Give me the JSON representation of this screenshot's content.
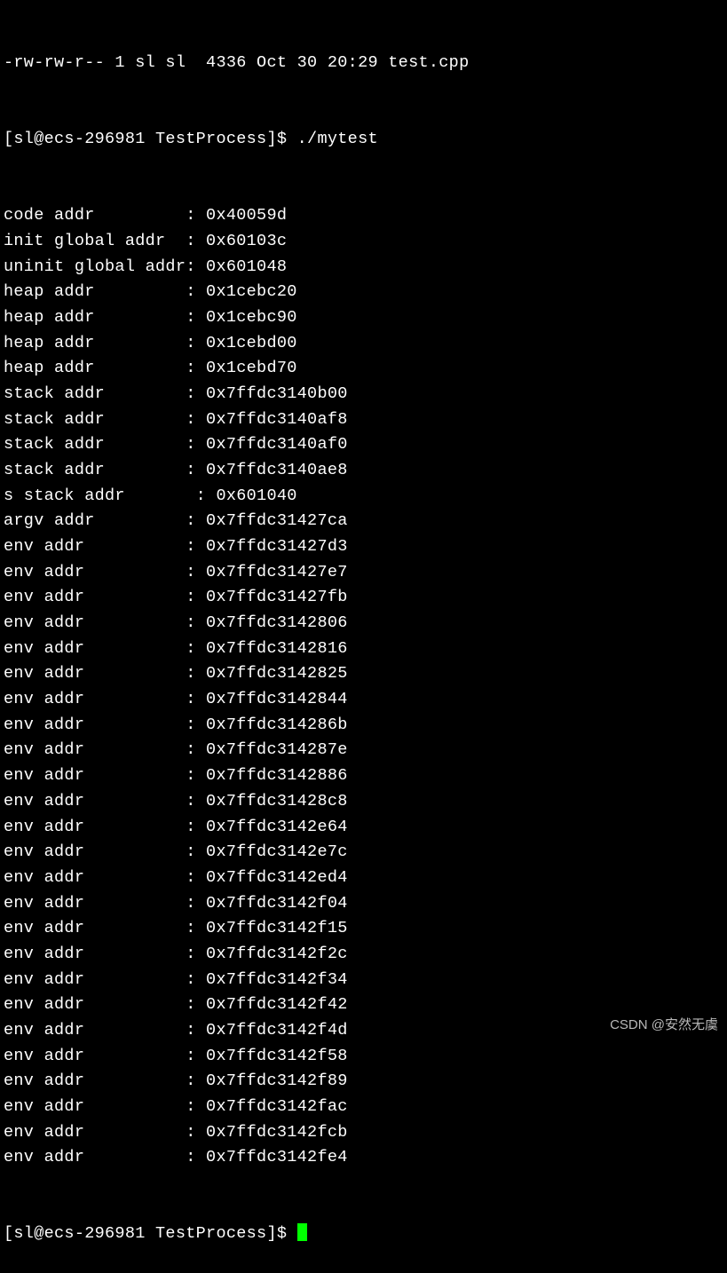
{
  "top_partial_line": "-rw-rw-r-- 1 sl sl  4336 Oct 30 20:29 test.cpp",
  "prompt1": "[sl@ecs-296981 TestProcess]$ ",
  "command1": "./mytest",
  "output_lines": [
    {
      "label": "code addr         ",
      "sep": ": ",
      "value": "0x40059d"
    },
    {
      "label": "init global addr  ",
      "sep": ": ",
      "value": "0x60103c"
    },
    {
      "label": "uninit global addr",
      "sep": ": ",
      "value": "0x601048"
    },
    {
      "label": "heap addr         ",
      "sep": ": ",
      "value": "0x1cebc20"
    },
    {
      "label": "heap addr         ",
      "sep": ": ",
      "value": "0x1cebc90"
    },
    {
      "label": "heap addr         ",
      "sep": ": ",
      "value": "0x1cebd00"
    },
    {
      "label": "heap addr         ",
      "sep": ": ",
      "value": "0x1cebd70"
    },
    {
      "label": "stack addr        ",
      "sep": ": ",
      "value": "0x7ffdc3140b00"
    },
    {
      "label": "stack addr        ",
      "sep": ": ",
      "value": "0x7ffdc3140af8"
    },
    {
      "label": "stack addr        ",
      "sep": ": ",
      "value": "0x7ffdc3140af0"
    },
    {
      "label": "stack addr        ",
      "sep": ": ",
      "value": "0x7ffdc3140ae8"
    },
    {
      "label": "s stack addr      ",
      "sep": " : ",
      "value": "0x601040"
    },
    {
      "label": "argv addr         ",
      "sep": ": ",
      "value": "0x7ffdc31427ca"
    },
    {
      "label": "env addr          ",
      "sep": ": ",
      "value": "0x7ffdc31427d3"
    },
    {
      "label": "env addr          ",
      "sep": ": ",
      "value": "0x7ffdc31427e7"
    },
    {
      "label": "env addr          ",
      "sep": ": ",
      "value": "0x7ffdc31427fb"
    },
    {
      "label": "env addr          ",
      "sep": ": ",
      "value": "0x7ffdc3142806"
    },
    {
      "label": "env addr          ",
      "sep": ": ",
      "value": "0x7ffdc3142816"
    },
    {
      "label": "env addr          ",
      "sep": ": ",
      "value": "0x7ffdc3142825"
    },
    {
      "label": "env addr          ",
      "sep": ": ",
      "value": "0x7ffdc3142844"
    },
    {
      "label": "env addr          ",
      "sep": ": ",
      "value": "0x7ffdc314286b"
    },
    {
      "label": "env addr          ",
      "sep": ": ",
      "value": "0x7ffdc314287e"
    },
    {
      "label": "env addr          ",
      "sep": ": ",
      "value": "0x7ffdc3142886"
    },
    {
      "label": "env addr          ",
      "sep": ": ",
      "value": "0x7ffdc31428c8"
    },
    {
      "label": "env addr          ",
      "sep": ": ",
      "value": "0x7ffdc3142e64"
    },
    {
      "label": "env addr          ",
      "sep": ": ",
      "value": "0x7ffdc3142e7c"
    },
    {
      "label": "env addr          ",
      "sep": ": ",
      "value": "0x7ffdc3142ed4"
    },
    {
      "label": "env addr          ",
      "sep": ": ",
      "value": "0x7ffdc3142f04"
    },
    {
      "label": "env addr          ",
      "sep": ": ",
      "value": "0x7ffdc3142f15"
    },
    {
      "label": "env addr          ",
      "sep": ": ",
      "value": "0x7ffdc3142f2c"
    },
    {
      "label": "env addr          ",
      "sep": ": ",
      "value": "0x7ffdc3142f34"
    },
    {
      "label": "env addr          ",
      "sep": ": ",
      "value": "0x7ffdc3142f42"
    },
    {
      "label": "env addr          ",
      "sep": ": ",
      "value": "0x7ffdc3142f4d"
    },
    {
      "label": "env addr          ",
      "sep": ": ",
      "value": "0x7ffdc3142f58"
    },
    {
      "label": "env addr          ",
      "sep": ": ",
      "value": "0x7ffdc3142f89"
    },
    {
      "label": "env addr          ",
      "sep": ": ",
      "value": "0x7ffdc3142fac"
    },
    {
      "label": "env addr          ",
      "sep": ": ",
      "value": "0x7ffdc3142fcb"
    },
    {
      "label": "env addr          ",
      "sep": ": ",
      "value": "0x7ffdc3142fe4"
    }
  ],
  "prompt2": "[sl@ecs-296981 TestProcess]$ ",
  "watermark": "CSDN @安然无虞"
}
